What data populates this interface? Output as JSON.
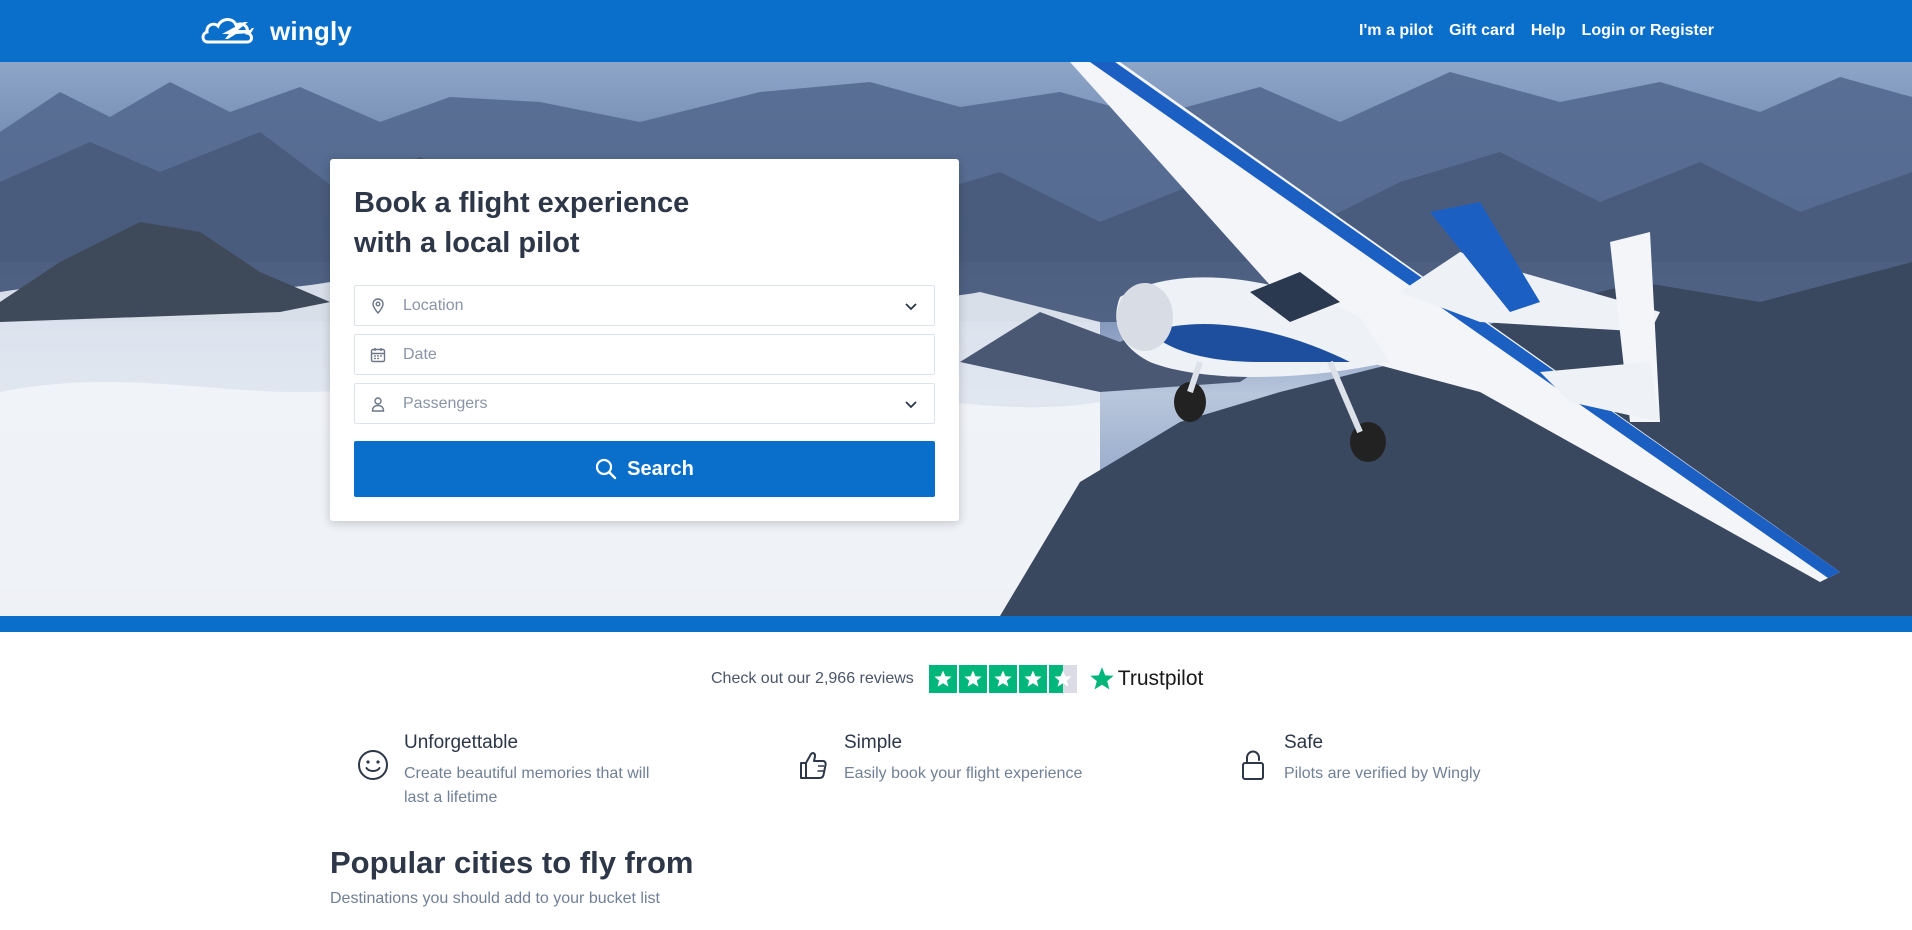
{
  "brand": {
    "name": "wingly",
    "primary_color": "#0a6fcb"
  },
  "nav": {
    "items": [
      {
        "label": "I'm a pilot"
      },
      {
        "label": "Gift card"
      },
      {
        "label": "Help"
      },
      {
        "label": "Login or Register"
      }
    ]
  },
  "hero": {
    "image": "small-plane-over-mountains-and-clouds",
    "card": {
      "title_line1": "Book a flight experience",
      "title_line2": "with a local pilot",
      "location": {
        "placeholder": "Location",
        "icon": "map-pin-icon"
      },
      "date": {
        "placeholder": "Date",
        "icon": "calendar-icon"
      },
      "passengers": {
        "placeholder": "Passengers",
        "icon": "user-icon"
      },
      "search_label": "Search"
    }
  },
  "trustpilot": {
    "text": "Check out our 2,966 reviews",
    "rating_stars": 4.5,
    "brand": "Trustpilot",
    "color": "#00b67a"
  },
  "features": [
    {
      "title": "Unforgettable",
      "description": "Create beautiful memories that will last a lifetime",
      "icon": "smile-icon"
    },
    {
      "title": "Simple",
      "description": "Easily book your flight experience",
      "icon": "thumbs-up-icon"
    },
    {
      "title": "Safe",
      "description": "Pilots are verified by Wingly",
      "icon": "lock-icon"
    }
  ],
  "popular": {
    "title": "Popular cities to fly from",
    "subtitle": "Destinations you should add to your bucket list"
  }
}
